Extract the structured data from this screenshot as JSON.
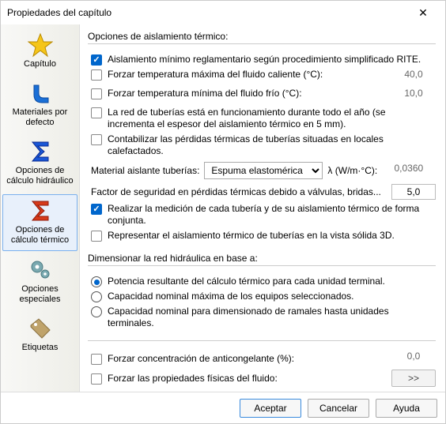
{
  "window": {
    "title": "Propiedades del capítulo"
  },
  "sidebar": {
    "items": [
      {
        "label": "Capítulo"
      },
      {
        "label": "Materiales por defecto"
      },
      {
        "label": "Opciones de cálculo hidráulico"
      },
      {
        "label": "Opciones de cálculo térmico"
      },
      {
        "label": "Opciones especiales"
      },
      {
        "label": "Etiquetas"
      }
    ]
  },
  "sections": {
    "insulation": {
      "legend": "Opciones de aislamiento térmico:",
      "min_insulation": "Aislamiento mínimo reglamentario según procedimiento simplificado RITE.",
      "force_hot": "Forzar temperatura máxima del fluido caliente (°C):",
      "force_hot_val": "40,0",
      "force_cold": "Forzar temperatura mínima del fluido frío (°C):",
      "force_cold_val": "10,0",
      "all_year": "La red de tuberías está en funcionamiento durante todo el año (se incrementa el espesor del aislamiento térmico en 5 mm).",
      "count_losses": "Contabilizar las pérdidas térmicas de tuberías situadas en locales calefactados.",
      "material_label": "Material aislante tuberías:",
      "material_value": "Espuma elastomérica",
      "lambda_label": "λ (W/m·°C):",
      "lambda_value": "0,0360",
      "safety_label": "Factor de seguridad en pérdidas térmicas debido a válvulas, bridas...",
      "safety_value": "5,0",
      "joint_measure": "Realizar la medición de cada tubería y de su aislamiento térmico de forma conjunta.",
      "solid_view": "Representar el aislamiento térmico de tuberías en la vista sólida 3D."
    },
    "sizing": {
      "legend": "Dimensionar la red hidráulica en base a:",
      "opt1": "Potencia resultante del cálculo térmico para cada unidad terminal.",
      "opt2": "Capacidad nominal máxima de los equipos seleccionados.",
      "opt3": "Capacidad nominal para dimensionado de ramales hasta unidades terminales."
    },
    "bottom": {
      "antifreeze": "Forzar concentración de anticongelante (%):",
      "antifreeze_val": "0,0",
      "fluid_props": "Forzar las propiedades físicas del fluido:",
      "fluid_btn": ">>"
    }
  },
  "buttons": {
    "ok": "Aceptar",
    "cancel": "Cancelar",
    "help": "Ayuda"
  }
}
